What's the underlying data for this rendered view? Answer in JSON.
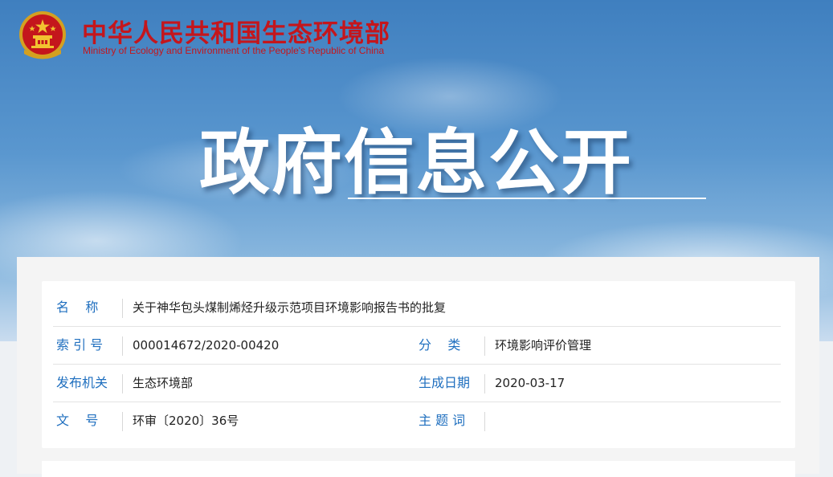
{
  "header": {
    "ministry_cn": "中华人民共和国生态环境部",
    "ministry_en": "Ministry of Ecology and Environment of the People's Republic of China",
    "hero_title": "政府信息公开",
    "emblem_icon": "national-emblem-icon"
  },
  "colors": {
    "brand_red": "#c4161c",
    "label_blue": "#1f6fbf"
  },
  "info": {
    "name_label": "名    称",
    "name_value": "关于神华包头煤制烯烃升级示范项目环境影响报告书的批复",
    "index_label": "索 引 号",
    "index_value": "000014672/2020-00420",
    "category_label": "分    类",
    "category_value": "环境影响评价管理",
    "publisher_label": "发布机关",
    "publisher_value": "生态环境部",
    "date_label": "生成日期",
    "date_value": "2020-03-17",
    "docno_label": "文    号",
    "docno_value": "环审〔2020〕36号",
    "subject_label": "主 题 词",
    "subject_value": ""
  }
}
